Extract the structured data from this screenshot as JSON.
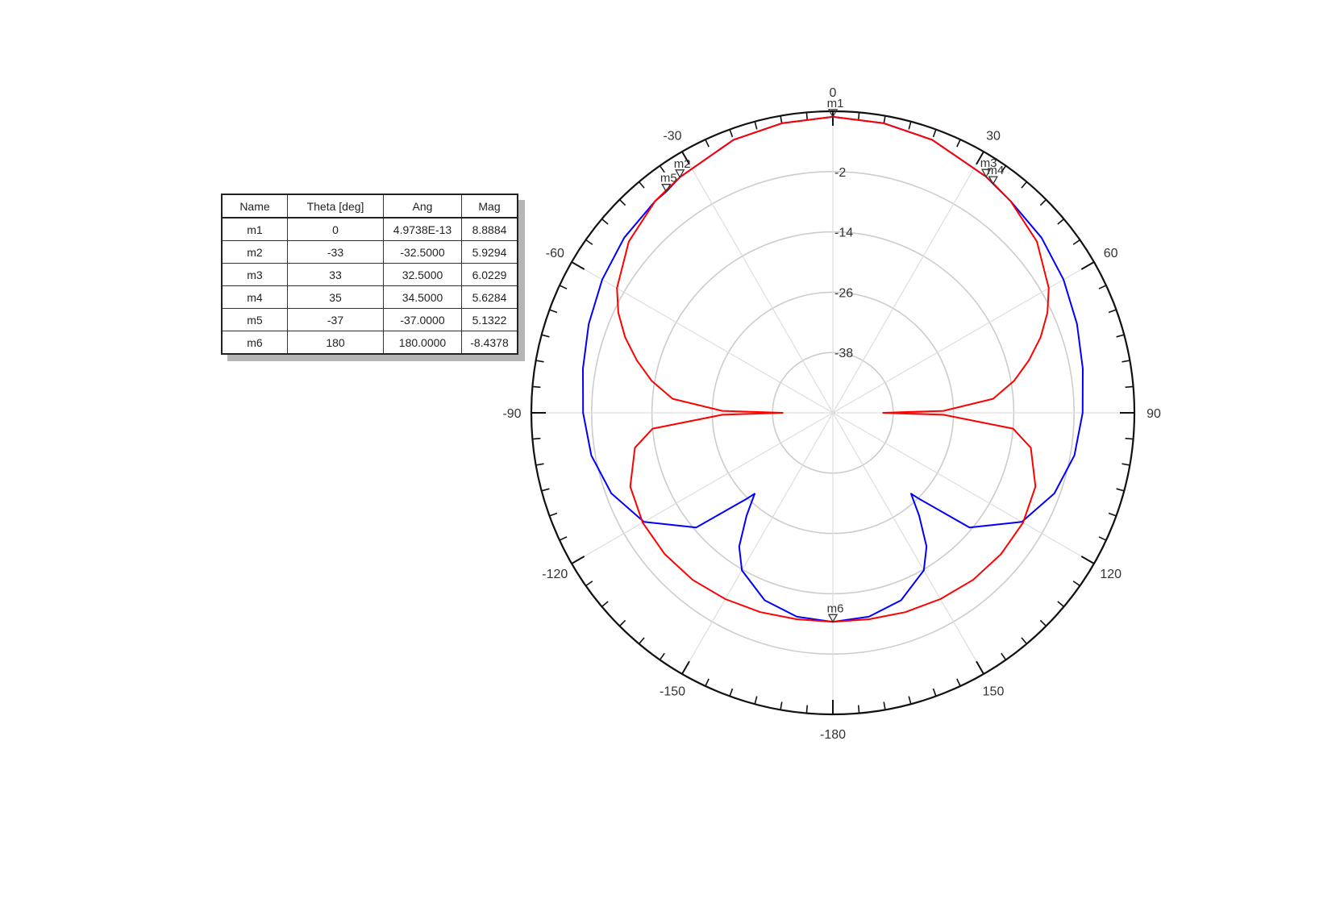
{
  "marker_table": {
    "columns": [
      "Name",
      "Theta [deg]",
      "Ang",
      "Mag"
    ],
    "rows": [
      [
        "m1",
        "0",
        "4.9738E-13",
        "8.8884"
      ],
      [
        "m2",
        "-33",
        "-32.5000",
        "5.9294"
      ],
      [
        "m3",
        "33",
        "32.5000",
        "6.0229"
      ],
      [
        "m4",
        "35",
        "34.5000",
        "5.6284"
      ],
      [
        "m5",
        "-37",
        "-37.0000",
        "5.1322"
      ],
      [
        "m6",
        "180",
        "180.0000",
        "-8.4378"
      ]
    ]
  },
  "chart_data": {
    "type": "line",
    "subtype": "polar",
    "angle_labels": [
      "0",
      "30",
      "60",
      "90",
      "120",
      "150",
      "-180",
      "-150",
      "-120",
      "-90",
      "-60",
      "-30"
    ],
    "angle_label_values": [
      0,
      30,
      60,
      90,
      120,
      150,
      180,
      210,
      240,
      270,
      300,
      330
    ],
    "radial_labels": [
      "-2",
      "-14",
      "-26",
      "-38"
    ],
    "radial_values": [
      -2,
      -14,
      -26,
      -38
    ],
    "radial_range": [
      -50,
      10
    ],
    "grid": true,
    "series_colors": [
      "#0000ff",
      "#ff0000"
    ],
    "series": [
      {
        "color": "#0000ff",
        "theta": [
          -180,
          -170,
          -160,
          -150,
          -145,
          -140,
          -136,
          -135,
          -130,
          -120,
          -110,
          -100,
          -90,
          -80,
          -70,
          -60,
          -50,
          -40,
          -37,
          -33,
          -20,
          -10,
          0,
          10,
          20,
          33,
          35,
          40,
          50,
          60,
          70,
          80,
          90,
          100,
          110,
          120,
          130,
          135,
          136,
          140,
          145,
          150,
          160,
          170,
          180
        ],
        "r": [
          -8.4,
          -8.8,
          -10.3,
          -13.8,
          -17.5,
          -23.3,
          -27.6,
          -25.9,
          -14.5,
          -6.6,
          -3.1,
          -1.2,
          -0.3,
          0.5,
          1.7,
          3.0,
          4.2,
          5.0,
          5.1,
          5.9,
          7.8,
          8.5,
          8.9,
          8.5,
          7.8,
          6.0,
          5.6,
          5.0,
          4.2,
          3.0,
          1.7,
          0.5,
          -0.3,
          -1.2,
          -3.1,
          -6.6,
          -14.5,
          -25.9,
          -27.6,
          -23.3,
          -17.5,
          -13.8,
          -10.3,
          -8.8,
          -8.4
        ]
      },
      {
        "color": "#ff0000",
        "theta": [
          -180,
          -170,
          -160,
          -150,
          -140,
          -130,
          -120,
          -110,
          -100,
          -95,
          -91,
          -90,
          -89,
          -85,
          -80,
          -75,
          -70,
          -65,
          -60,
          -50,
          -40,
          -37,
          -33,
          -20,
          -10,
          0,
          10,
          20,
          33,
          35,
          40,
          50,
          60,
          65,
          70,
          75,
          80,
          85,
          89,
          90,
          91,
          95,
          100,
          110,
          120,
          130,
          140,
          150,
          160,
          170,
          180
        ],
        "r": [
          -8.4,
          -8.3,
          -7.8,
          -7.2,
          -6.6,
          -6.3,
          -6.3,
          -7.1,
          -10.0,
          -14.0,
          -28.0,
          -40.0,
          -28.0,
          -18.0,
          -13.4,
          -9.6,
          -6.0,
          -2.9,
          -0.4,
          3.0,
          5.0,
          5.3,
          5.9,
          7.8,
          8.5,
          8.9,
          8.5,
          7.8,
          6.0,
          5.7,
          5.0,
          3.0,
          -0.4,
          -2.9,
          -6.0,
          -9.6,
          -13.4,
          -18.0,
          -28.0,
          -40.0,
          -28.0,
          -14.0,
          -10.0,
          -7.1,
          -6.3,
          -6.3,
          -6.6,
          -7.2,
          -7.8,
          -8.3,
          -8.4
        ]
      }
    ],
    "markers": [
      {
        "name": "m1",
        "theta": 0,
        "r": 8.9
      },
      {
        "name": "m2",
        "theta": -33,
        "r": 5.9
      },
      {
        "name": "m3",
        "theta": 33,
        "r": 6.0
      },
      {
        "name": "m4",
        "theta": 35,
        "r": 5.6
      },
      {
        "name": "m5",
        "theta": -37,
        "r": 5.1
      },
      {
        "name": "m6",
        "theta": 180,
        "r": -8.4
      }
    ]
  }
}
